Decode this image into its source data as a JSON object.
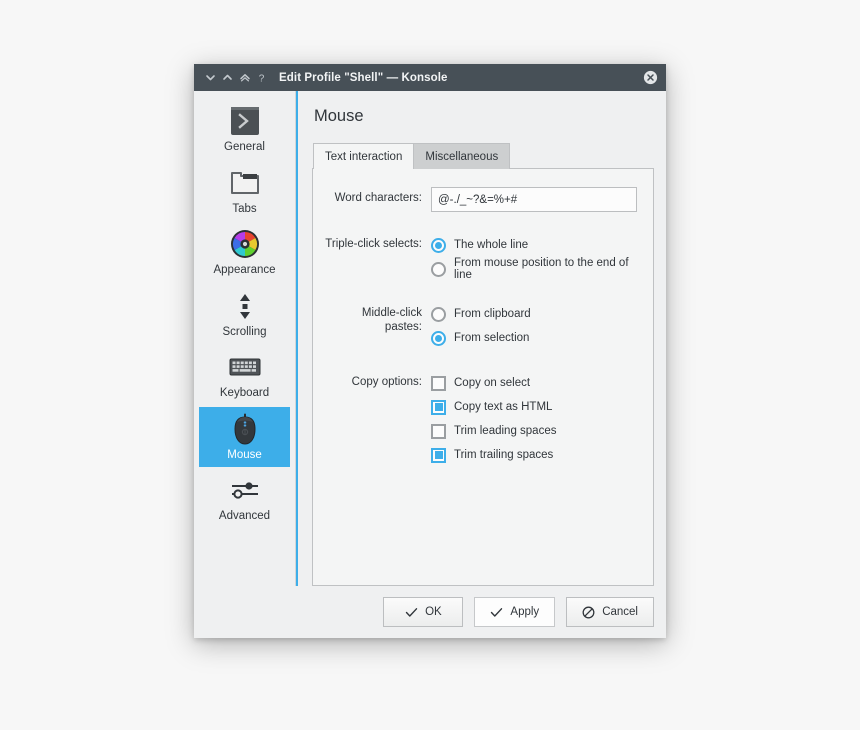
{
  "window": {
    "title": "Edit Profile \"Shell\" — Konsole",
    "titlebar_buttons": [
      {
        "name": "shade-down-icon",
        "glyph": "chevron-down"
      },
      {
        "name": "shade-up-icon",
        "glyph": "chevron-up"
      },
      {
        "name": "keep-above-icon",
        "glyph": "chevron-double-up"
      },
      {
        "name": "help-icon",
        "glyph": "question"
      }
    ],
    "close_label": "Close"
  },
  "sidebar": {
    "items": [
      {
        "label": "General",
        "icon": "terminal-prompt-icon",
        "selected": false
      },
      {
        "label": "Tabs",
        "icon": "folder-icon",
        "selected": false
      },
      {
        "label": "Appearance",
        "icon": "color-wheel-icon",
        "selected": false
      },
      {
        "label": "Scrolling",
        "icon": "scroll-arrows-icon",
        "selected": false
      },
      {
        "label": "Keyboard",
        "icon": "keyboard-icon",
        "selected": false
      },
      {
        "label": "Mouse",
        "icon": "mouse-icon",
        "selected": true
      },
      {
        "label": "Advanced",
        "icon": "sliders-icon",
        "selected": false
      }
    ]
  },
  "main": {
    "page_title": "Mouse",
    "tabs": [
      {
        "label": "Text interaction",
        "active": true
      },
      {
        "label": "Miscellaneous",
        "active": false
      }
    ],
    "word_characters": {
      "label": "Word characters:",
      "value": "@-./_~?&=%+#",
      "placeholder": ""
    },
    "triple_click": {
      "label": "Triple-click selects:",
      "options": [
        {
          "label": "The whole line",
          "checked": true
        },
        {
          "label": "From mouse position to the end of line",
          "checked": false
        }
      ]
    },
    "middle_click": {
      "label": "Middle-click pastes:",
      "options": [
        {
          "label": "From clipboard",
          "checked": false
        },
        {
          "label": "From selection",
          "checked": true
        }
      ]
    },
    "copy_options": {
      "label": "Copy options:",
      "options": [
        {
          "label": "Copy on select",
          "checked": false
        },
        {
          "label": "Copy text as HTML",
          "checked": true
        },
        {
          "label": "Trim leading spaces",
          "checked": false
        },
        {
          "label": "Trim trailing spaces",
          "checked": true
        }
      ]
    }
  },
  "buttons": [
    {
      "label": "OK",
      "icon": "check-icon",
      "hover": false
    },
    {
      "label": "Apply",
      "icon": "check-icon",
      "hover": true
    },
    {
      "label": "Cancel",
      "icon": "cancel-icon",
      "hover": false
    }
  ],
  "colors": {
    "accent": "#3daee9",
    "titlebar": "#475057",
    "window_bg": "#eff0f1",
    "panel_bg": "#f4f5f5",
    "text": "#31363b",
    "page_bg": "#f7f7f7"
  }
}
